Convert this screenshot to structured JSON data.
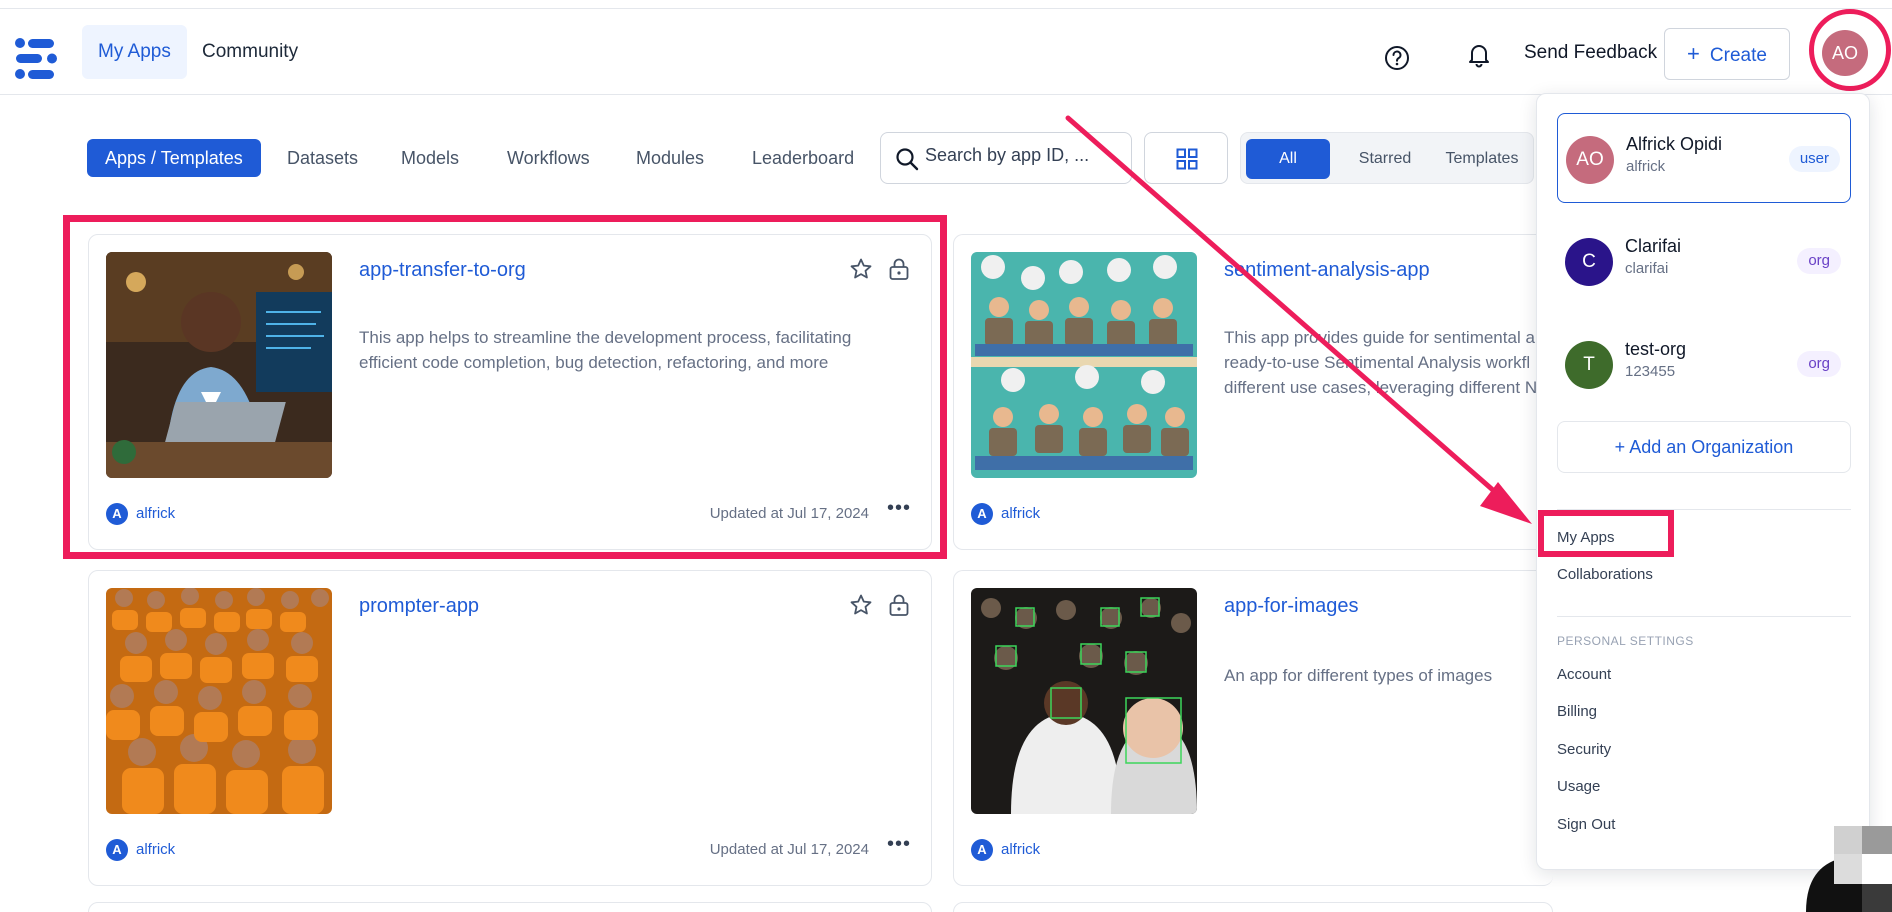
{
  "nav": {
    "tabs": [
      {
        "label": "My Apps"
      },
      {
        "label": "Community"
      }
    ],
    "send_feedback": "Send Feedback",
    "create_label": "Create",
    "avatar_initials": "AO"
  },
  "toolbar": {
    "tabs": [
      {
        "label": "Apps / Templates"
      },
      {
        "label": "Datasets"
      },
      {
        "label": "Models"
      },
      {
        "label": "Workflows"
      },
      {
        "label": "Modules"
      },
      {
        "label": "Leaderboard"
      }
    ],
    "search_placeholder": "Search by app ID, ...",
    "filters": [
      {
        "label": "All"
      },
      {
        "label": "Starred"
      },
      {
        "label": "Templates"
      }
    ]
  },
  "cards": [
    {
      "title": "app-transfer-to-org",
      "description": "This app helps to streamline the development process, facilitating efficient code completion, bug detection, refactoring, and more",
      "owner_initial": "A",
      "owner": "alfrick",
      "updated": "Updated at Jul 17, 2024"
    },
    {
      "title": "sentiment-analysis-app",
      "description": "This app provides guide for sentimental a ready-to-use Sentimental Analysis workfl different use cases, leveraging different N",
      "owner_initial": "A",
      "owner": "alfrick"
    },
    {
      "title": "prompter-app",
      "description": "",
      "owner_initial": "A",
      "owner": "alfrick",
      "updated": "Updated at Jul 17, 2024"
    },
    {
      "title": "app-for-images",
      "description": "An app for different types of images",
      "owner_initial": "A",
      "owner": "alfrick"
    }
  ],
  "dropdown": {
    "accounts": [
      {
        "initials": "AO",
        "name": "Alfrick Opidi",
        "sub": "alfrick",
        "role": "user",
        "color": "#c56b7d"
      },
      {
        "initials": "C",
        "name": "Clarifai",
        "sub": "clarifai",
        "role": "org",
        "color": "#2a148a"
      },
      {
        "initials": "T",
        "name": "test-org",
        "sub": "123455",
        "role": "org",
        "color": "#3e6b2b"
      }
    ],
    "add_org": "+ Add an Organization",
    "my_apps": "My Apps",
    "collaborations": "Collaborations",
    "personal_settings_heading": "PERSONAL SETTINGS",
    "settings": [
      {
        "label": "Account"
      },
      {
        "label": "Billing"
      },
      {
        "label": "Security"
      },
      {
        "label": "Usage"
      },
      {
        "label": "Sign Out"
      }
    ]
  },
  "colors": {
    "accent": "#1f5bd6",
    "annotation": "#ed1d5b"
  }
}
